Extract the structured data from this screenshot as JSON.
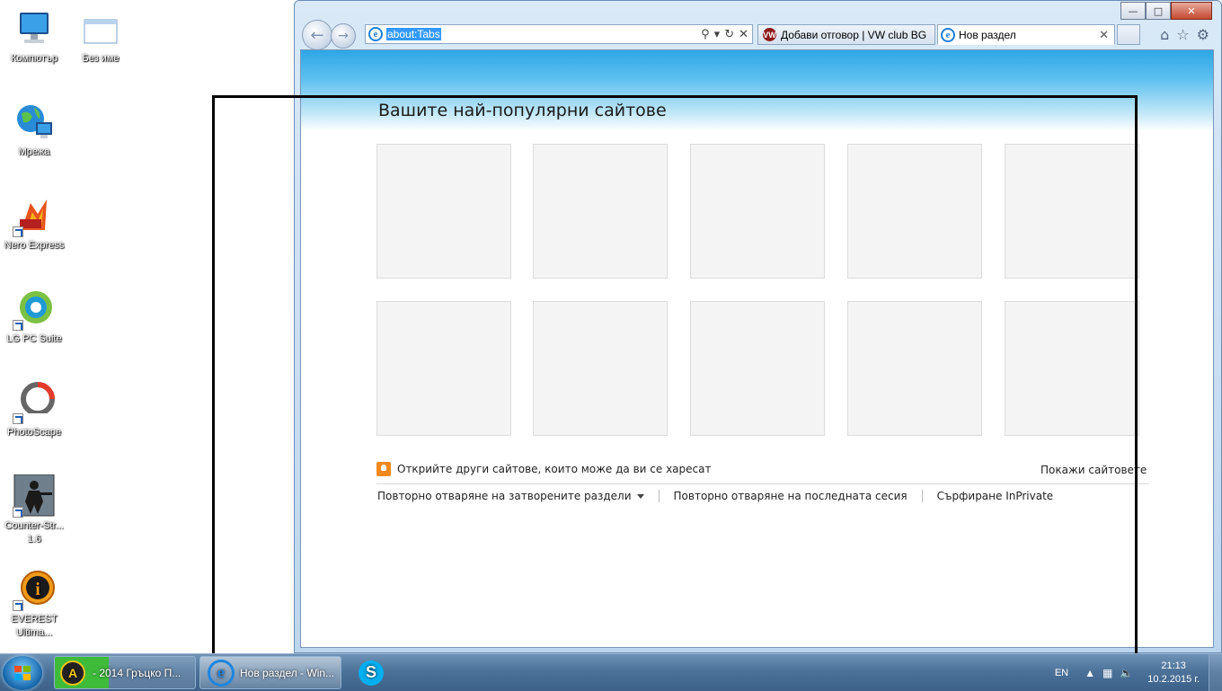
{
  "desktop": {
    "icons": [
      {
        "label": "Компютър",
        "icon": "computer-icon"
      },
      {
        "label": "Без име",
        "icon": "blank-window-icon"
      },
      {
        "label": "Мрежа",
        "icon": "network-icon"
      },
      {
        "label": "Nero Express",
        "icon": "nero-icon"
      },
      {
        "label": "LG PC Suite",
        "icon": "lg-pc-suite-icon"
      },
      {
        "label": "PhotoScape",
        "icon": "photoscape-icon"
      },
      {
        "label": "Counter-Str... 1.6",
        "icon": "counter-strike-icon"
      },
      {
        "label": "EVEREST Ultima...",
        "icon": "everest-icon"
      }
    ]
  },
  "browser": {
    "address": "about:Tabs",
    "tabs": [
      {
        "label": "Добави отговор | VW club BG",
        "icon": "vw-icon"
      },
      {
        "label": "Нов раздел",
        "icon": "ie-icon"
      }
    ],
    "window_controls": {
      "minimize": "—",
      "maximize": "□",
      "close": "✕"
    }
  },
  "newtab_page": {
    "heading": "Вашите най-популярни сайтове",
    "discover_text": "Открийте други сайтове, които може да ви се харесат",
    "show_sites": "Покажи сайтовете",
    "reopen_closed": "Повторно отваряне на затворените раздели",
    "reopen_session": "Повторно отваряне на последната сесия",
    "inprivate": "Сърфиране InPrivate"
  },
  "taskbar": {
    "items": [
      {
        "label": "- 2014 Гръцко П...",
        "icon": "aimp-icon"
      },
      {
        "label": "Нов раздел - Win...",
        "icon": "ie-icon"
      },
      {
        "label": "",
        "icon": "skype-icon"
      }
    ],
    "language": "EN",
    "time": "21:13",
    "date": "10.2.2015 г."
  },
  "colors": {
    "content_header": "#2ea6e6",
    "tile_bg": "#f4f4f4",
    "taskbar": "#4c7299",
    "bulb": "#f2891e"
  }
}
